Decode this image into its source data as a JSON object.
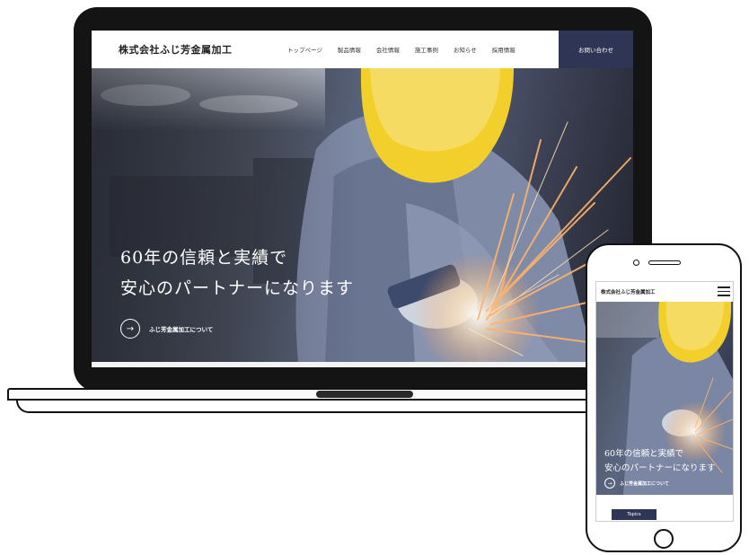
{
  "desktop": {
    "logo": "株式会社ふじ芳金属加工",
    "nav": [
      "トップページ",
      "製品情報",
      "会社情報",
      "施工事例",
      "お知らせ",
      "採用情報"
    ],
    "contact": "お問い合わせ",
    "hero": {
      "line1": "60年の信頼と実績で",
      "line2": "安心のパートナーになります",
      "link_label": "ふじ芳金属加工について",
      "link_arrow": "→"
    }
  },
  "mobile": {
    "logo": "株式会社ふじ芳金属加工",
    "hero": {
      "line1": "60年の信頼と実績で",
      "line2": "安心のパートナーになります",
      "link_label": "ふじ芳金属加工について",
      "link_arrow": "→"
    },
    "topics": "Topics"
  },
  "colors": {
    "accent": "#2f3555",
    "helmet": "#f2cf2a"
  },
  "icons": [
    "menu-icon",
    "arrow-right-icon"
  ]
}
